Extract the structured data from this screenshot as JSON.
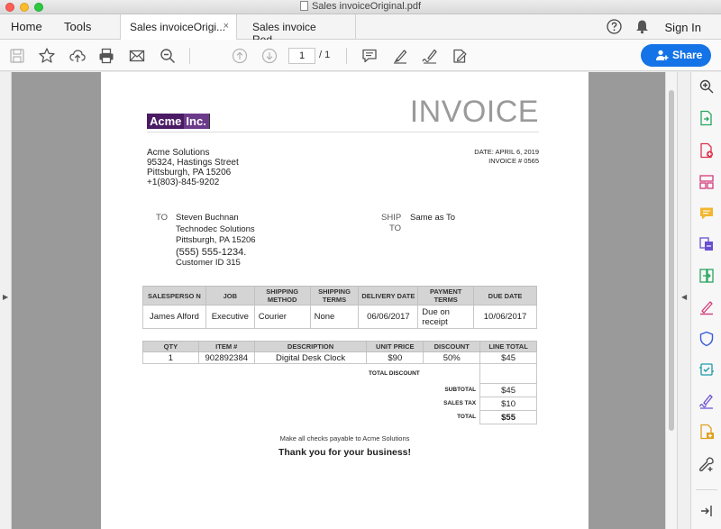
{
  "window": {
    "title": "Sales invoiceOriginal.pdf"
  },
  "menu": {
    "home": "Home",
    "tools": "Tools",
    "sign_in": "Sign In"
  },
  "tabs": [
    {
      "label": "Sales invoiceOrigi...",
      "close": "×"
    },
    {
      "label": "Sales invoice Red..."
    }
  ],
  "toolbar": {
    "page_current": "1",
    "page_total": "/ 1",
    "share_label": "Share"
  },
  "invoice": {
    "logo_part1": "Acme",
    "logo_part2": "Inc.",
    "title": "INVOICE",
    "from": [
      "Acme Solutions",
      "95324, Hastings Street",
      "Pittsburgh, PA 15206",
      "+1(803)-845-9202"
    ],
    "date": "DATE: APRIL 6, 2019",
    "invoice_no": "INVOICE # 0565",
    "to_label": "TO",
    "to_name": "Steven Buchnan",
    "to_company": "Technodec Solutions",
    "to_city": "Pittsburgh, PA 15206",
    "to_phone": "(555) 555-1234.",
    "to_customer": "Customer ID 315",
    "ship_label1": "SHIP",
    "ship_label2": "TO",
    "ship_value": "Same as To",
    "table1": {
      "headers": [
        "SALESPERSO N",
        "JOB",
        "SHIPPING METHOD",
        "SHIPPING TERMS",
        "DELIVERY DATE",
        "PAYMENT TERMS",
        "DUE DATE"
      ],
      "row": [
        "James Alford",
        "Executive",
        "Courier",
        "None",
        "06/06/2017",
        "Due on receipt",
        "10/06/2017"
      ]
    },
    "table2": {
      "headers": [
        "QTY",
        "ITEM #",
        "DESCRIPTION",
        "UNIT PRICE",
        "DISCOUNT",
        "LINE TOTAL"
      ],
      "row": [
        "1",
        "902892384",
        "Digital Desk Clock",
        "$90",
        "50%",
        "$45"
      ],
      "total_discount_label": "TOTAL DISCOUNT",
      "subtotal_label": "SUBTOTAL",
      "subtotal": "$45",
      "sales_tax_label": "SALES TAX",
      "sales_tax": "$10",
      "total_label": "TOTAL",
      "total": "$55"
    },
    "payable_note": "Make all checks payable to Acme Solutions",
    "thanks": "Thank you for your business!"
  }
}
